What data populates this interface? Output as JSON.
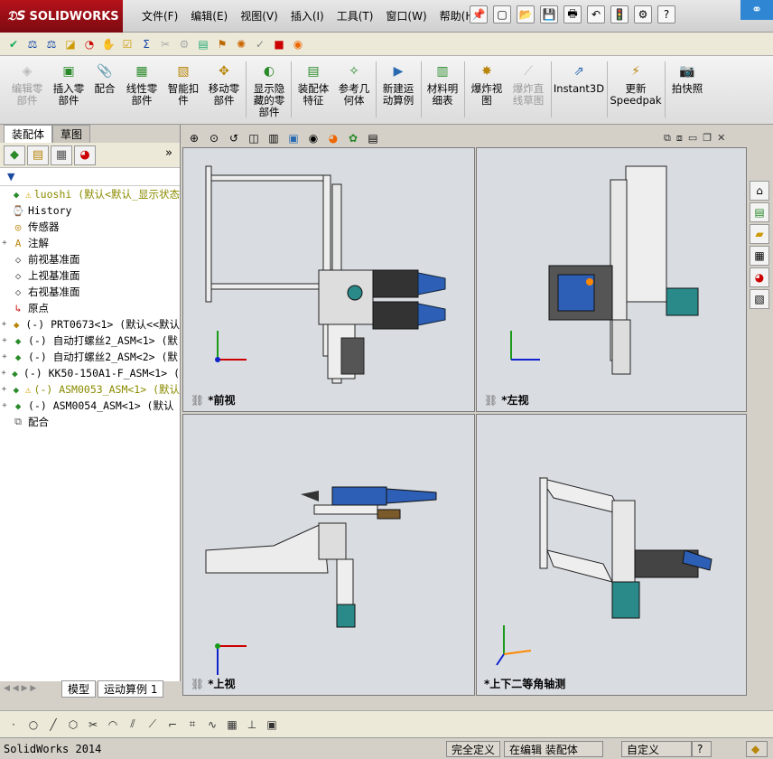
{
  "app": {
    "brand": "SOLIDWORKS",
    "status_app_name": "SolidWorks 2014"
  },
  "menu": [
    "文件(F)",
    "编辑(E)",
    "视图(V)",
    "插入(I)",
    "工具(T)",
    "窗口(W)",
    "帮助(H)"
  ],
  "command_manager": {
    "buttons": [
      {
        "label": "编辑零\n部件",
        "icon": "edit-component-icon",
        "disabled": true
      },
      {
        "label": "插入零\n部件",
        "icon": "insert-component-icon",
        "disabled": false
      },
      {
        "label": "配合",
        "icon": "mate-icon",
        "disabled": false
      },
      {
        "label": "线性零\n部件",
        "icon": "linear-pattern-icon",
        "disabled": false
      },
      {
        "label": "智能扣\n件",
        "icon": "smart-fasteners-icon",
        "disabled": false
      },
      {
        "label": "移动零\n部件",
        "icon": "move-component-icon",
        "disabled": false
      },
      {
        "label": "显示隐\n藏的零\n部件",
        "icon": "show-hidden-icon",
        "disabled": false
      },
      {
        "label": "装配体\n特征",
        "icon": "assembly-feature-icon",
        "disabled": false
      },
      {
        "label": "参考几\n何体",
        "icon": "reference-geometry-icon",
        "disabled": false
      },
      {
        "label": "新建运\n动算例",
        "icon": "new-motion-study-icon",
        "disabled": false
      },
      {
        "label": "材料明\n细表",
        "icon": "bom-icon",
        "disabled": false
      },
      {
        "label": "爆炸视\n图",
        "icon": "exploded-view-icon",
        "disabled": false
      },
      {
        "label": "爆炸直\n线草图",
        "icon": "explode-line-icon",
        "disabled": true
      },
      {
        "label": "Instant3D",
        "icon": "instant3d-icon",
        "disabled": false
      },
      {
        "label": "更新\nSpeedpak",
        "icon": "speedpak-icon",
        "disabled": false
      },
      {
        "label": "拍快照",
        "icon": "snapshot-icon",
        "disabled": false
      }
    ]
  },
  "feature_manager": {
    "tabs": [
      "装配体",
      "草图"
    ],
    "bottom_tabs": [
      "模型",
      "运动算例 1"
    ],
    "tree": [
      {
        "label": "luoshi  (默认<默认_显示状态",
        "icon": "assembly-icon",
        "warn": true,
        "expand": ""
      },
      {
        "label": "History",
        "icon": "history-icon",
        "warn": false,
        "expand": ""
      },
      {
        "label": "传感器",
        "icon": "sensor-icon",
        "warn": false,
        "expand": ""
      },
      {
        "label": "注解",
        "icon": "annotation-icon",
        "warn": false,
        "expand": "+"
      },
      {
        "label": "前视基准面",
        "icon": "plane-icon",
        "warn": false,
        "expand": ""
      },
      {
        "label": "上视基准面",
        "icon": "plane-icon",
        "warn": false,
        "expand": ""
      },
      {
        "label": "右视基准面",
        "icon": "plane-icon",
        "warn": false,
        "expand": ""
      },
      {
        "label": "原点",
        "icon": "origin-icon",
        "warn": false,
        "expand": ""
      },
      {
        "label": "(-) PRT0673<1> (默认<<默认",
        "icon": "part-icon",
        "warn": false,
        "expand": "+"
      },
      {
        "label": "(-) 自动打螺丝2_ASM<1> (默",
        "icon": "subassembly-icon",
        "warn": false,
        "expand": "+"
      },
      {
        "label": "(-) 自动打螺丝2_ASM<2> (默",
        "icon": "subassembly-icon",
        "warn": false,
        "expand": "+"
      },
      {
        "label": "(-) KK50-150A1-F_ASM<1> (",
        "icon": "subassembly-icon",
        "warn": false,
        "expand": "+"
      },
      {
        "label": "(-) ASM0053_ASM<1> (默认",
        "icon": "subassembly-icon",
        "warn": true,
        "expand": "+"
      },
      {
        "label": "(-) ASM0054_ASM<1> (默认",
        "icon": "subassembly-icon",
        "warn": false,
        "expand": "+"
      },
      {
        "label": "配合",
        "icon": "mates-folder-icon",
        "warn": false,
        "expand": ""
      }
    ]
  },
  "viewports": [
    {
      "name": "*前视"
    },
    {
      "name": "*左视"
    },
    {
      "name": "*上视"
    },
    {
      "name": "*上下二等角轴测"
    }
  ],
  "status_bar": {
    "state": "完全定义",
    "editing": "在编辑 装配体",
    "units": "自定义"
  },
  "colors": {
    "viewport_bg": "#d9dde2",
    "part_blue": "#2c5fb5",
    "metal": "#e3e3e3",
    "dark": "#222222"
  }
}
